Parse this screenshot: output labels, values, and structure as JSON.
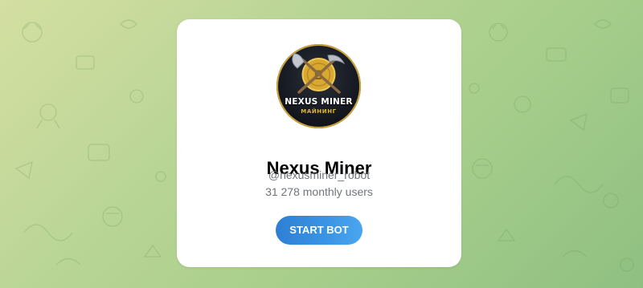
{
  "bot": {
    "name": "Nexus Miner",
    "username": "@nexusminer_robot",
    "monthly_users": "31 278 monthly users",
    "start_button_label": "START BOT"
  },
  "avatar": {
    "title": "NEXUS MINER",
    "subtitle": "МАЙНИНГ",
    "icon": "pickaxe-shovel-coin-icon"
  },
  "colors": {
    "button": "#3a8ee0",
    "background": "#b5d493",
    "secondary_text": "#707579",
    "coin_gold": "#d9a830"
  }
}
